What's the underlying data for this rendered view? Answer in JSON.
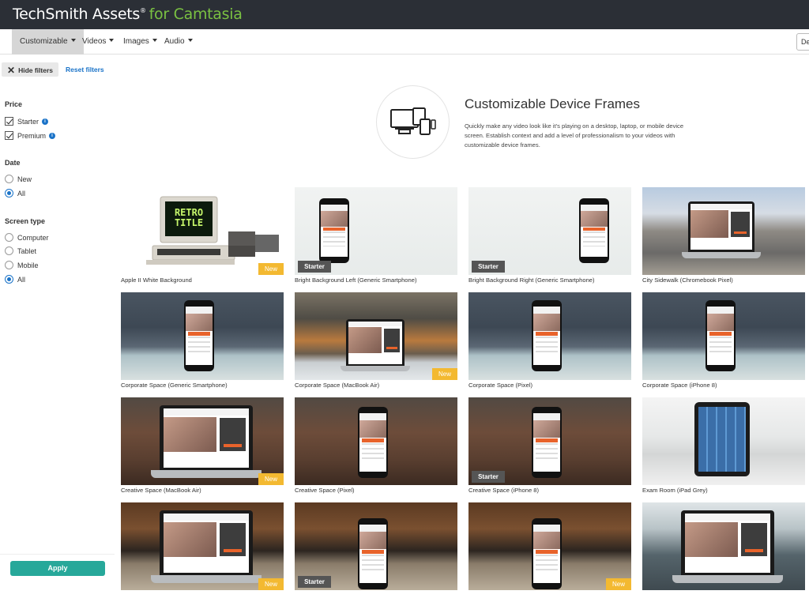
{
  "brand": {
    "name": "TechSmith Assets",
    "reg": "®",
    "suffix": "for Camtasia"
  },
  "nav": {
    "items": [
      {
        "label": "Customizable",
        "active": true
      },
      {
        "label": "Videos",
        "active": false
      },
      {
        "label": "Images",
        "active": false
      },
      {
        "label": "Audio",
        "active": false
      }
    ],
    "search_value": "De"
  },
  "filters": {
    "hide_label": "Hide filters",
    "reset_label": "Reset filters",
    "price": {
      "title": "Price",
      "options": [
        {
          "label": "Starter",
          "checked": true
        },
        {
          "label": "Premium",
          "checked": true
        }
      ]
    },
    "date": {
      "title": "Date",
      "options": [
        {
          "label": "New",
          "selected": false
        },
        {
          "label": "All",
          "selected": true
        }
      ]
    },
    "screen_type": {
      "title": "Screen type",
      "options": [
        {
          "label": "Computer",
          "selected": false
        },
        {
          "label": "Tablet",
          "selected": false
        },
        {
          "label": "Mobile",
          "selected": false
        },
        {
          "label": "All",
          "selected": true
        }
      ]
    },
    "apply_label": "Apply"
  },
  "hero": {
    "title": "Customizable Device Frames",
    "description": "Quickly make any video look like it's playing on a desktop, laptop, or mobile device screen. Establish context and add a level of professionalism to your videos with customizable device frames.",
    "icon": "devices-icon"
  },
  "retro_text": {
    "line1": "RETRO",
    "line2": "TITLE"
  },
  "cards": [
    {
      "title": "Apple II White Background",
      "badge": "New",
      "scene": "retro"
    },
    {
      "title": "Bright Background Left (Generic Smartphone)",
      "badge": "Starter",
      "scene": "phone-light-left"
    },
    {
      "title": "Bright Background Right (Generic Smartphone)",
      "badge": "Starter",
      "scene": "phone-light-right"
    },
    {
      "title": "City Sidewalk (Chromebook Pixel)",
      "badge": "",
      "scene": "laptop-city"
    },
    {
      "title": "Corporate Space (Generic Smartphone)",
      "badge": "",
      "scene": "phone-corp"
    },
    {
      "title": "Corporate Space (MacBook Air)",
      "badge": "New",
      "scene": "laptop-corp"
    },
    {
      "title": "Corporate Space (Pixel)",
      "badge": "",
      "scene": "phone-corp"
    },
    {
      "title": "Corporate Space (iPhone 8)",
      "badge": "",
      "scene": "phone-corp"
    },
    {
      "title": "Creative Space (MacBook Air)",
      "badge": "New",
      "scene": "laptop-creative"
    },
    {
      "title": "Creative Space (Pixel)",
      "badge": "",
      "scene": "phone-creative"
    },
    {
      "title": "Creative Space (iPhone 8)",
      "badge": "Starter",
      "scene": "phone-creative"
    },
    {
      "title": "Exam Room (iPad Grey)",
      "badge": "",
      "scene": "tablet-exam"
    },
    {
      "title": "",
      "badge": "New",
      "scene": "laptop-kitchen"
    },
    {
      "title": "",
      "badge": "Starter",
      "scene": "phone-kitchen"
    },
    {
      "title": "",
      "badge": "New",
      "scene": "phone-kitchen"
    },
    {
      "title": "",
      "badge": "",
      "scene": "laptop-class"
    }
  ]
}
